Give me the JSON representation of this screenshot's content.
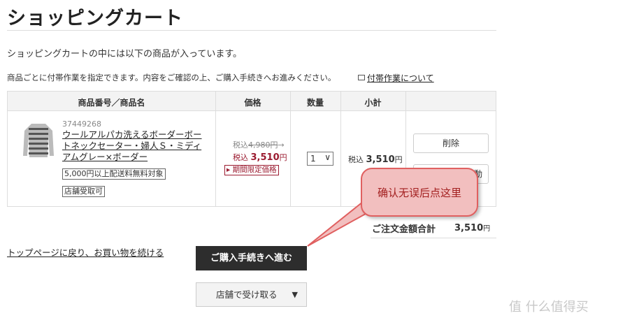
{
  "header": {
    "title": "ショッピングカート"
  },
  "intro": "ショッピングカートの中には以下の商品が入っています。",
  "note": "商品ごとに付帯作業を指定できます。内容をご確認の上、ご購入手続きへお進みください。",
  "note_link": "付帯作業について",
  "table": {
    "columns": [
      "商品番号／商品名",
      "価格",
      "数量",
      "小計"
    ],
    "item": {
      "code": "37449268",
      "name": "ウールアルパカ洗えるボーダーボートネックセーター・婦人Ｓ・ミディアムグレー×ボーダー",
      "tags": [
        "5,000円以上配送料無料対象",
        "店舗受取可"
      ],
      "price_original_prefix": "税込",
      "price_original": "4,980円",
      "price_original_arrow": "→",
      "price_sale_prefix": "税込",
      "price_sale": "3,510",
      "price_sale_unit": "円",
      "limited_label": "期間限定価格",
      "limited_icon": "▸",
      "quantity": "1",
      "quantity_chevron": "∨",
      "subtotal_prefix": "税込",
      "subtotal_value": "3,510",
      "subtotal_unit": "円",
      "delete_label": "削除",
      "second_button_partial": "動"
    }
  },
  "total": {
    "label": "ご注文金額合計",
    "value": "3,510",
    "unit": "円"
  },
  "links": {
    "back": "トップページに戻り、お買い物を続ける"
  },
  "buttons": {
    "checkout": "ご購入手続きへ進む",
    "store_pickup": "店舗で受け取る",
    "store_pickup_arrow": "▼"
  },
  "callout": {
    "text": "确认无误后点这里"
  },
  "watermark": "值 什么值得买",
  "colors": {
    "sale_red": "#9b1b30",
    "callout_fill": "#f2bfbf",
    "callout_border": "#e06060",
    "checkout_bg": "#2d2d2d"
  }
}
